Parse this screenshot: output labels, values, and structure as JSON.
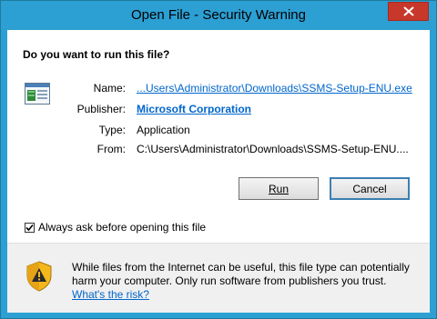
{
  "window": {
    "title": "Open File - Security Warning"
  },
  "dialog": {
    "question": "Do you want to run this file?",
    "fields": [
      {
        "label": "Name:",
        "value": "...Users\\Administrator\\Downloads\\SSMS-Setup-ENU.exe"
      },
      {
        "label": "Publisher:",
        "value": "Microsoft Corporation"
      },
      {
        "label": "Type:",
        "value": "Application"
      },
      {
        "label": "From:",
        "value": "C:\\Users\\Administrator\\Downloads\\SSMS-Setup-ENU...."
      }
    ],
    "run_label": "Run",
    "cancel_label": "Cancel",
    "checkbox_label": "Always ask before opening this file",
    "checkbox_checked": true,
    "warning_text": "While files from the Internet can be useful, this file type can potentially harm your computer. Only run software from publishers you trust.",
    "risk_link": "What's the risk?"
  },
  "colors": {
    "titlebar": "#2c9fd3",
    "close": "#c7382b",
    "link": "#0066cc"
  },
  "icons": [
    "close-icon",
    "application-file-icon",
    "warning-shield-icon",
    "checkmark-icon"
  ]
}
